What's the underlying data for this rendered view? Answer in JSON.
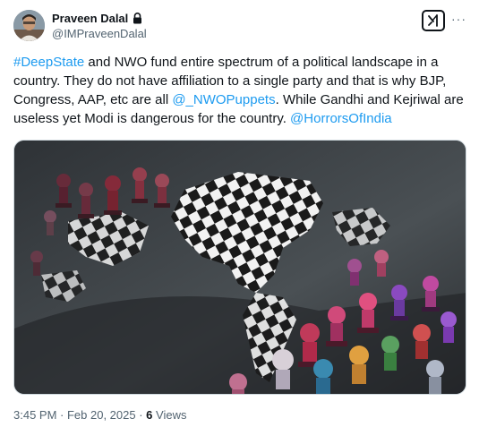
{
  "author": {
    "display_name": "Praveen Dalal",
    "handle": "@IMPraveenDalal",
    "avatar_icon": "user-avatar",
    "verified_icon": "lock-icon"
  },
  "actions": {
    "grok_icon": "grok-icon",
    "more_label": "···"
  },
  "tweet": {
    "segments": [
      {
        "text": "#DeepState",
        "link": true
      },
      {
        "text": " and NWO fund entire spectrum of a political landscape in a country. They do not have affiliation to a single party and that is why BJP, Congress, AAP, etc are all ",
        "link": false
      },
      {
        "text": "@_NWOPuppets",
        "link": true
      },
      {
        "text": ". While Gandhi and Kejriwal are useless yet Modi is dangerous for the country. ",
        "link": false
      },
      {
        "text": "@HorrorsOfIndia",
        "link": true
      }
    ]
  },
  "media": {
    "description_icon": "chessboard-map-image"
  },
  "meta": {
    "time": "3:45 PM",
    "sep1": " · ",
    "date": "Feb 20, 2025",
    "sep2": " · ",
    "views_count": "6",
    "views_label": " Views"
  },
  "colors": {
    "link": "#1d9bf0",
    "text": "#0f1419",
    "secondary": "#536471"
  }
}
